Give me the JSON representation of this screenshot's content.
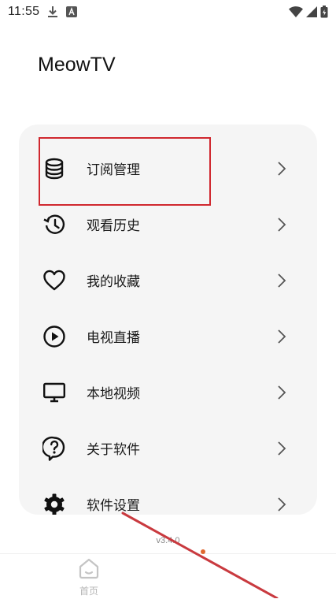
{
  "status_bar": {
    "time": "11:55",
    "icons": [
      "download-icon",
      "app-a-icon",
      "wifi-icon",
      "signal-icon",
      "battery-icon"
    ]
  },
  "app": {
    "title": "MeowTV"
  },
  "menu": {
    "items": [
      {
        "icon": "database-icon",
        "label": "订阅管理"
      },
      {
        "icon": "history-icon",
        "label": "观看历史"
      },
      {
        "icon": "heart-icon",
        "label": "我的收藏"
      },
      {
        "icon": "play-circle-icon",
        "label": "电视直播"
      },
      {
        "icon": "monitor-icon",
        "label": "本地视频"
      },
      {
        "icon": "help-icon",
        "label": "关于软件"
      },
      {
        "icon": "gear-icon",
        "label": "软件设置"
      }
    ]
  },
  "version": "v3.4.0",
  "bottom_nav": {
    "home_label": "首页"
  },
  "colors": {
    "accent_highlight": "#d0282f",
    "card_bg": "#f5f5f5",
    "nav_inactive": "#b5b5b5"
  }
}
